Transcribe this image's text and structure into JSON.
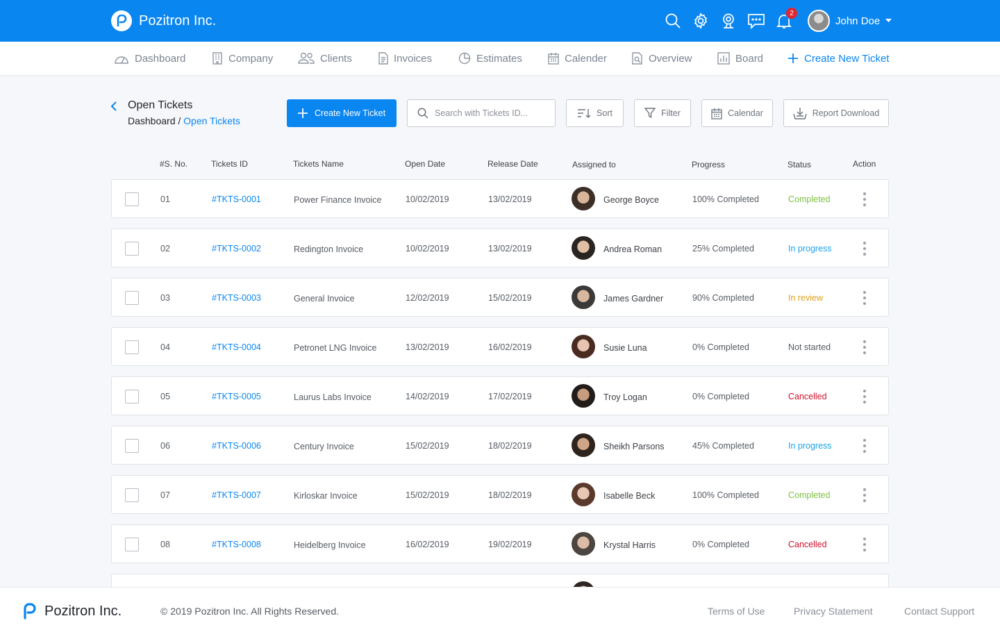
{
  "app": {
    "brand": "Pozitron Inc.",
    "notification_count": "2",
    "user_name": "John Doe"
  },
  "nav": [
    {
      "label": "Dashboard",
      "icon": "dashboard-icon"
    },
    {
      "label": "Company",
      "icon": "building-icon"
    },
    {
      "label": "Clients",
      "icon": "clients-icon"
    },
    {
      "label": "Invoices",
      "icon": "invoice-icon"
    },
    {
      "label": "Estimates",
      "icon": "pie-chart-icon"
    },
    {
      "label": "Calender",
      "icon": "calendar-icon"
    },
    {
      "label": "Overview",
      "icon": "overview-icon"
    },
    {
      "label": "Board",
      "icon": "board-icon"
    },
    {
      "label": "Create New Ticket",
      "icon": "plus-icon"
    }
  ],
  "page": {
    "title": "Open Tickets",
    "breadcrumb_root": "Dashboard",
    "breadcrumb_sep": " / ",
    "breadcrumb_current": "Open Tickets"
  },
  "toolbar": {
    "create_label": "Create New Ticket",
    "search_placeholder": "Search with Tickets ID...",
    "sort_label": "Sort",
    "filter_label": "Filter",
    "calendar_label": "Calendar",
    "report_label": "Report Download"
  },
  "table": {
    "columns": [
      "#S. No.",
      "Tickets ID",
      "Tickets Name",
      "Open Date",
      "Release Date",
      "Assigned to",
      "Progress",
      "Status",
      "Action"
    ],
    "rows": [
      {
        "sno": "01",
        "id": "#TKTS-0001",
        "name": "Power Finance Invoice",
        "open": "10/02/2019",
        "release": "13/02/2019",
        "assignee": "George Boyce",
        "progress": "100% Completed",
        "status": "Completed",
        "status_color": "#7cc142"
      },
      {
        "sno": "02",
        "id": "#TKTS-0002",
        "name": "Redington Invoice",
        "open": "10/02/2019",
        "release": "13/02/2019",
        "assignee": "Andrea Roman",
        "progress": "25% Completed",
        "status": "In progress",
        "status_color": "#1aa3e8"
      },
      {
        "sno": "03",
        "id": "#TKTS-0003",
        "name": "General Invoice",
        "open": "12/02/2019",
        "release": "15/02/2019",
        "assignee": "James Gardner",
        "progress": "90% Completed",
        "status": "In review",
        "status_color": "#e3a21a"
      },
      {
        "sno": "04",
        "id": "#TKTS-0004",
        "name": "Petronet LNG Invoice",
        "open": "13/02/2019",
        "release": "16/02/2019",
        "assignee": "Susie Luna",
        "progress": "0% Completed",
        "status": "Not started",
        "status_color": "#555b63"
      },
      {
        "sno": "05",
        "id": "#TKTS-0005",
        "name": "Laurus Labs Invoice",
        "open": "14/02/2019",
        "release": "17/02/2019",
        "assignee": "Troy Logan",
        "progress": "0% Completed",
        "status": "Cancelled",
        "status_color": "#d0102b"
      },
      {
        "sno": "06",
        "id": "#TKTS-0006",
        "name": "Century Invoice",
        "open": "15/02/2019",
        "release": "18/02/2019",
        "assignee": "Sheikh Parsons",
        "progress": "45% Completed",
        "status": "In progress",
        "status_color": "#1aa3e8"
      },
      {
        "sno": "07",
        "id": "#TKTS-0007",
        "name": "Kirloskar Invoice",
        "open": "15/02/2019",
        "release": "18/02/2019",
        "assignee": "Isabelle Beck",
        "progress": "100% Completed",
        "status": "Completed",
        "status_color": "#7cc142"
      },
      {
        "sno": "08",
        "id": "#TKTS-0008",
        "name": "Heidelberg Invoice",
        "open": "16/02/2019",
        "release": "19/02/2019",
        "assignee": "Krystal Harris",
        "progress": "0% Completed",
        "status": "Cancelled",
        "status_color": "#d0102b"
      }
    ]
  },
  "footer": {
    "brand": "Pozitron Inc.",
    "copyright": "© 2019 Pozitron Inc. All Rights Reserved.",
    "links": [
      "Terms of Use",
      "Privacy Statement",
      "Contact Support"
    ]
  },
  "colors": {
    "primary": "#0a86f0",
    "background": "#f5f7fa"
  }
}
